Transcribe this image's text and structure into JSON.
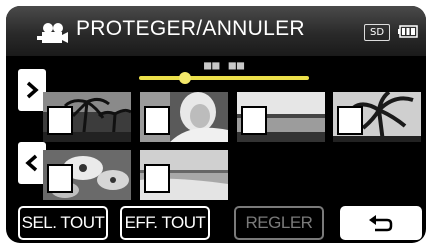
{
  "header": {
    "title": "PROTEGER/ANNULER",
    "mode_icon": "movie-camera-icon",
    "media_badge": "SD",
    "battery_icon": "battery-icon"
  },
  "scrubber": {
    "position_dots": "■■ ■■",
    "position_fraction": 0.25
  },
  "nav": {
    "next_icon": "chevron-right-icon",
    "prev_icon": "chevron-left-icon"
  },
  "thumbnails": [
    {
      "scene": "palm-trees-dark",
      "checked": false
    },
    {
      "scene": "person-portrait",
      "checked": false
    },
    {
      "scene": "lake-horizon",
      "checked": false
    },
    {
      "scene": "palm-silhouette-sky",
      "checked": false
    },
    {
      "scene": "flowers-closeup",
      "checked": false
    },
    {
      "scene": "beach-shore",
      "checked": false
    }
  ],
  "buttons": {
    "select_all": "SEL. TOUT",
    "clear_all": "EFF. TOUT",
    "set": "REGLER",
    "back_icon": "return-arrow-icon"
  }
}
